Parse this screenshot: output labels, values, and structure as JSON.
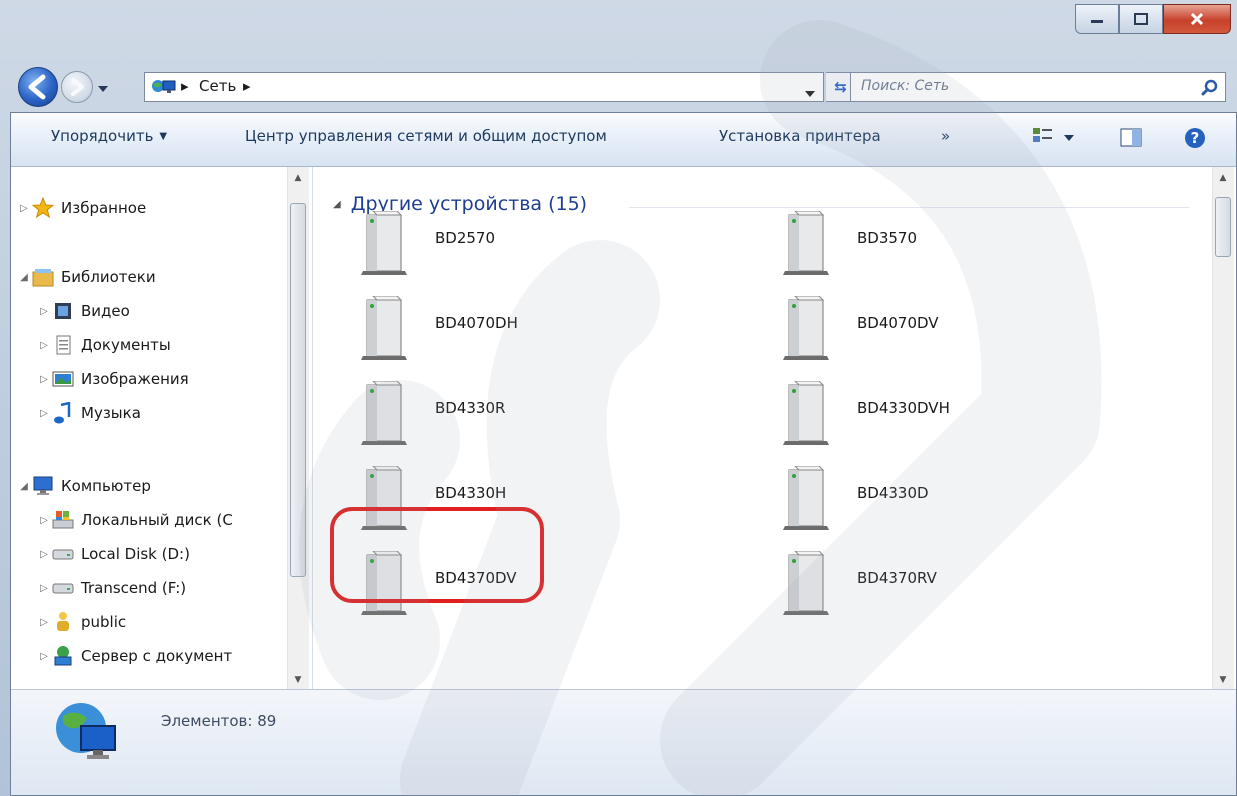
{
  "address_bar": {
    "crumbs": [
      "Сеть"
    ],
    "search_placeholder": "Поиск: Сеть"
  },
  "toolbar": {
    "organize": "Упорядочить",
    "network_center": "Центр управления сетями и общим доступом",
    "add_printer": "Установка принтера",
    "more": "»"
  },
  "sidebar": {
    "items": [
      {
        "label": "Избранное",
        "icon": "star-icon",
        "level": 0
      },
      {
        "label": "Библиотеки",
        "icon": "library-icon",
        "level": 0
      },
      {
        "label": "Видео",
        "icon": "video-icon",
        "level": 1
      },
      {
        "label": "Документы",
        "icon": "document-icon",
        "level": 1
      },
      {
        "label": "Изображения",
        "icon": "image-icon",
        "level": 1
      },
      {
        "label": "Музыка",
        "icon": "music-icon",
        "level": 1
      },
      {
        "label": "Компьютер",
        "icon": "computer-icon",
        "level": 0
      },
      {
        "label": "Локальный диск (C",
        "icon": "disk-c-icon",
        "level": 1
      },
      {
        "label": "Local Disk (D:)",
        "icon": "drive-icon",
        "level": 1
      },
      {
        "label": "Transcend (F:)",
        "icon": "drive-icon",
        "level": 1
      },
      {
        "label": "public",
        "icon": "user-icon",
        "level": 1
      },
      {
        "label": "Сервер с документ",
        "icon": "server-icon",
        "level": 1
      }
    ]
  },
  "main": {
    "group_title": "Другие устройства (15)",
    "devices": [
      "BD2570",
      "BD3570",
      "BD4070DH",
      "BD4070DV",
      "BD4330R",
      "BD4330DVH",
      "BD4330H",
      "BD4330D",
      "BD4370DV",
      "BD4370RV"
    ]
  },
  "status": {
    "count_text": "Элементов: 89"
  },
  "colors": {
    "highlight": "#e02020",
    "link_text": "#1e3f8f",
    "chrome": "#bccbdd"
  }
}
